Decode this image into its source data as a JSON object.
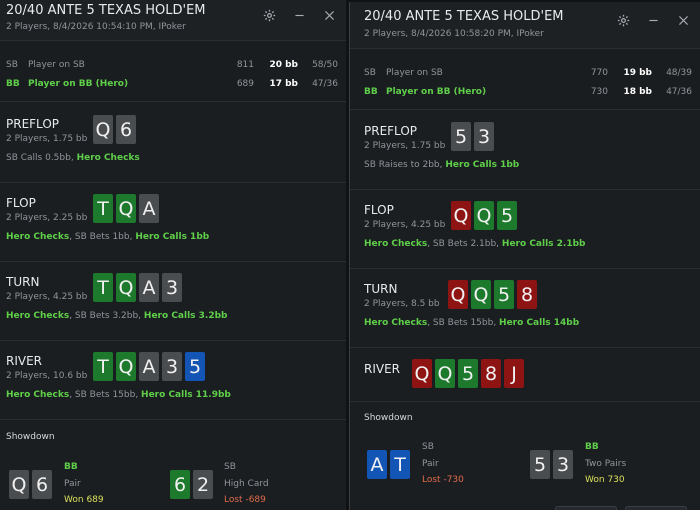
{
  "windows": [
    {
      "title": "20/40 ANTE 5 TEXAS HOLD'EM",
      "subtitle": "2 Players, 8/4/2026 10:54:10 PM, IPoker",
      "players": [
        {
          "pos": "SB",
          "name": "Player on SB",
          "chips": "811",
          "bb": "20 bb",
          "vpip": "58/50",
          "hero": false
        },
        {
          "pos": "BB",
          "name": "Player on BB (Hero)",
          "chips": "689",
          "bb": "17 bb",
          "vpip": "47/36",
          "hero": true
        }
      ],
      "streets": [
        {
          "name": "PREFLOP",
          "pot": "2 Players, 1.75 bb",
          "cards": [
            {
              "r": "Q",
              "c": "gray"
            },
            {
              "r": "6",
              "c": "gray"
            }
          ],
          "actions": [
            {
              "t": "SB Calls 0.5bb, ",
              "h": false
            },
            {
              "t": "Hero Checks",
              "h": true
            }
          ]
        },
        {
          "name": "FLOP",
          "pot": "2 Players, 2.25 bb",
          "cards": [
            {
              "r": "T",
              "c": "green"
            },
            {
              "r": "Q",
              "c": "green"
            },
            {
              "r": "A",
              "c": "gray"
            }
          ],
          "actions": [
            {
              "t": "Hero Checks",
              "h": true
            },
            {
              "t": ", SB Bets 1bb, ",
              "h": false
            },
            {
              "t": "Hero Calls 1bb",
              "h": true
            }
          ]
        },
        {
          "name": "TURN",
          "pot": "2 Players, 4.25 bb",
          "cards": [
            {
              "r": "T",
              "c": "green"
            },
            {
              "r": "Q",
              "c": "green"
            },
            {
              "r": "A",
              "c": "gray"
            },
            {
              "r": "3",
              "c": "gray"
            }
          ],
          "actions": [
            {
              "t": "Hero Checks",
              "h": true
            },
            {
              "t": ", SB Bets 3.2bb, ",
              "h": false
            },
            {
              "t": "Hero Calls 3.2bb",
              "h": true
            }
          ]
        },
        {
          "name": "RIVER",
          "pot": "2 Players, 10.6 bb",
          "cards": [
            {
              "r": "T",
              "c": "green"
            },
            {
              "r": "Q",
              "c": "green"
            },
            {
              "r": "A",
              "c": "gray"
            },
            {
              "r": "3",
              "c": "gray"
            },
            {
              "r": "5",
              "c": "blue"
            }
          ],
          "actions": [
            {
              "t": "Hero Checks",
              "h": true
            },
            {
              "t": ", SB Bets 15bb, ",
              "h": false
            },
            {
              "t": "Hero Calls 11.9bb",
              "h": true
            }
          ]
        }
      ],
      "showdown": {
        "title": "Showdown",
        "left": {
          "pos": "BB",
          "hand": "Pair",
          "result": "Won 689",
          "won": true,
          "cards": [
            {
              "r": "Q",
              "c": "gray"
            },
            {
              "r": "6",
              "c": "gray"
            }
          ]
        },
        "right": {
          "pos": "SB",
          "hand": "High Card",
          "result": "Lost -689",
          "won": false,
          "cards": [
            {
              "r": "6",
              "c": "green"
            },
            {
              "r": "2",
              "c": "gray"
            }
          ]
        }
      }
    },
    {
      "title": "20/40 ANTE 5 TEXAS HOLD'EM",
      "subtitle": "2 Players, 8/4/2026 10:58:20 PM, IPoker",
      "players": [
        {
          "pos": "SB",
          "name": "Player on SB",
          "chips": "770",
          "bb": "19 bb",
          "vpip": "48/39",
          "hero": false
        },
        {
          "pos": "BB",
          "name": "Player on BB (Hero)",
          "chips": "730",
          "bb": "18 bb",
          "vpip": "47/36",
          "hero": true
        }
      ],
      "streets": [
        {
          "name": "PREFLOP",
          "pot": "2 Players, 1.75 bb",
          "cards": [
            {
              "r": "5",
              "c": "gray"
            },
            {
              "r": "3",
              "c": "gray"
            }
          ],
          "actions": [
            {
              "t": "SB Raises to 2bb, ",
              "h": false
            },
            {
              "t": "Hero Calls 1bb",
              "h": true
            }
          ]
        },
        {
          "name": "FLOP",
          "pot": "2 Players, 4.25 bb",
          "cards": [
            {
              "r": "Q",
              "c": "red"
            },
            {
              "r": "Q",
              "c": "green"
            },
            {
              "r": "5",
              "c": "green"
            }
          ],
          "actions": [
            {
              "t": "Hero Checks",
              "h": true
            },
            {
              "t": ", SB Bets 2.1bb, ",
              "h": false
            },
            {
              "t": "Hero Calls 2.1bb",
              "h": true
            }
          ]
        },
        {
          "name": "TURN",
          "pot": "2 Players, 8.5 bb",
          "cards": [
            {
              "r": "Q",
              "c": "red"
            },
            {
              "r": "Q",
              "c": "green"
            },
            {
              "r": "5",
              "c": "green"
            },
            {
              "r": "8",
              "c": "red"
            }
          ],
          "actions": [
            {
              "t": "Hero Checks",
              "h": true
            },
            {
              "t": ", SB Bets 15bb, ",
              "h": false
            },
            {
              "t": "Hero Calls 14bb",
              "h": true
            }
          ]
        },
        {
          "name": "RIVER",
          "pot": "",
          "cards": [
            {
              "r": "Q",
              "c": "red"
            },
            {
              "r": "Q",
              "c": "green"
            },
            {
              "r": "5",
              "c": "green"
            },
            {
              "r": "8",
              "c": "red"
            },
            {
              "r": "J",
              "c": "red"
            }
          ],
          "actions": []
        }
      ],
      "showdown": {
        "title": "Showdown",
        "left": {
          "pos": "SB",
          "hand": "Pair",
          "result": "Lost -730",
          "won": false,
          "cards": [
            {
              "r": "A",
              "c": "blue"
            },
            {
              "r": "T",
              "c": "blue"
            }
          ]
        },
        "right": {
          "pos": "BB",
          "hand": "Two Pairs",
          "result": "Won 730",
          "won": true,
          "cards": [
            {
              "r": "5",
              "c": "gray"
            },
            {
              "r": "3",
              "c": "gray"
            }
          ]
        }
      }
    }
  ],
  "icons": {
    "settings": "gear-icon",
    "minimize": "minimize-icon",
    "close": "close-icon"
  },
  "colors": {
    "hero": "#5fcf4a",
    "won": "#d9e05a",
    "lost": "#e06a4a",
    "card_gray": "#4a4d50",
    "card_green": "#1d7a2c",
    "card_red": "#8e1414",
    "card_blue": "#1255b5"
  }
}
